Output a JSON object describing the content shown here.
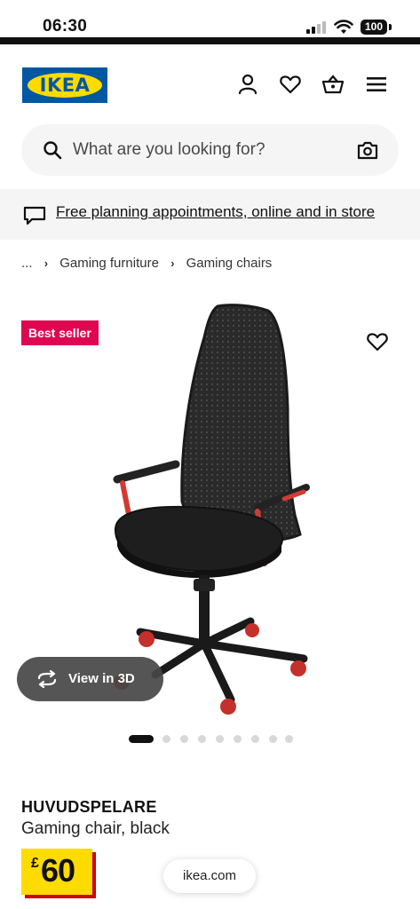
{
  "status_bar": {
    "time": "06:30",
    "battery": "100"
  },
  "header": {
    "logo_text": "IKEA"
  },
  "search": {
    "placeholder": "What are you looking for?"
  },
  "promo": {
    "link_text": "Free planning appointments, online and in store"
  },
  "breadcrumb": {
    "ellipsis": "...",
    "items": [
      "Gaming furniture",
      "Gaming chairs"
    ]
  },
  "gallery": {
    "badge": "Best seller",
    "view3d_label": "View in 3D",
    "image_count": 9,
    "active_image": 1
  },
  "product": {
    "name": "HUVUDSPELARE",
    "description": "Gaming chair, black",
    "price_currency": "£",
    "price_value": "60"
  },
  "browser": {
    "url": "ikea.com"
  },
  "colors": {
    "brand_blue": "#0058a3",
    "brand_yellow": "#ffdb00",
    "badge_red": "#e00751",
    "price_shadow": "#cc0008"
  },
  "icons": [
    "signal-icon",
    "wifi-icon",
    "battery-icon",
    "account-icon",
    "heart-icon",
    "basket-icon",
    "menu-icon",
    "search-icon",
    "camera-icon",
    "chat-icon",
    "chevron-right-icon",
    "rotate-3d-icon"
  ]
}
